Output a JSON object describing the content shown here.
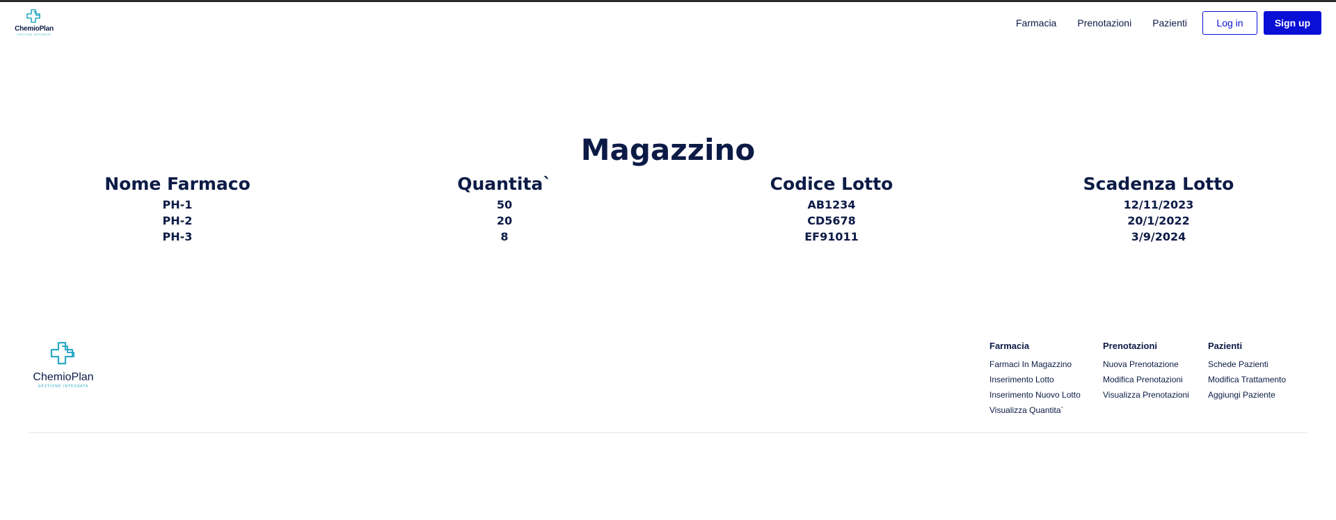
{
  "brand": {
    "name": "ChemioPlan",
    "tagline": "GESTIONE INTEGRATA",
    "color": "#2aa9c5"
  },
  "nav": {
    "links": [
      "Farmacia",
      "Prenotazioni",
      "Pazienti"
    ],
    "login_label": "Log in",
    "signup_label": "Sign up",
    "accent": "#0a0fd6"
  },
  "main": {
    "title": "Magazzino",
    "table": {
      "headers": [
        "Nome Farmaco",
        "Quantita`",
        "Codice Lotto",
        "Scadenza Lotto"
      ],
      "rows": [
        [
          "PH-1",
          "50",
          "AB1234",
          "12/11/2023"
        ],
        [
          "PH-2",
          "20",
          "CD5678",
          "20/1/2022"
        ],
        [
          "PH-3",
          "8",
          "EF91011",
          "3/9/2024"
        ]
      ]
    }
  },
  "footer": {
    "columns": [
      {
        "title": "Farmacia",
        "links": [
          "Farmaci In Magazzino",
          "Inserimento Lotto",
          "Inserimento Nuovo Lotto",
          "Visualizza Quantita`"
        ]
      },
      {
        "title": "Prenotazioni",
        "links": [
          "Nuova Prenotazione",
          "Modifica Prenotazioni",
          "Visualizza Prenotazioni"
        ]
      },
      {
        "title": "Pazienti",
        "links": [
          "Schede Pazienti",
          "Modifica Trattamento",
          "Aggiungi Paziente"
        ]
      }
    ]
  }
}
